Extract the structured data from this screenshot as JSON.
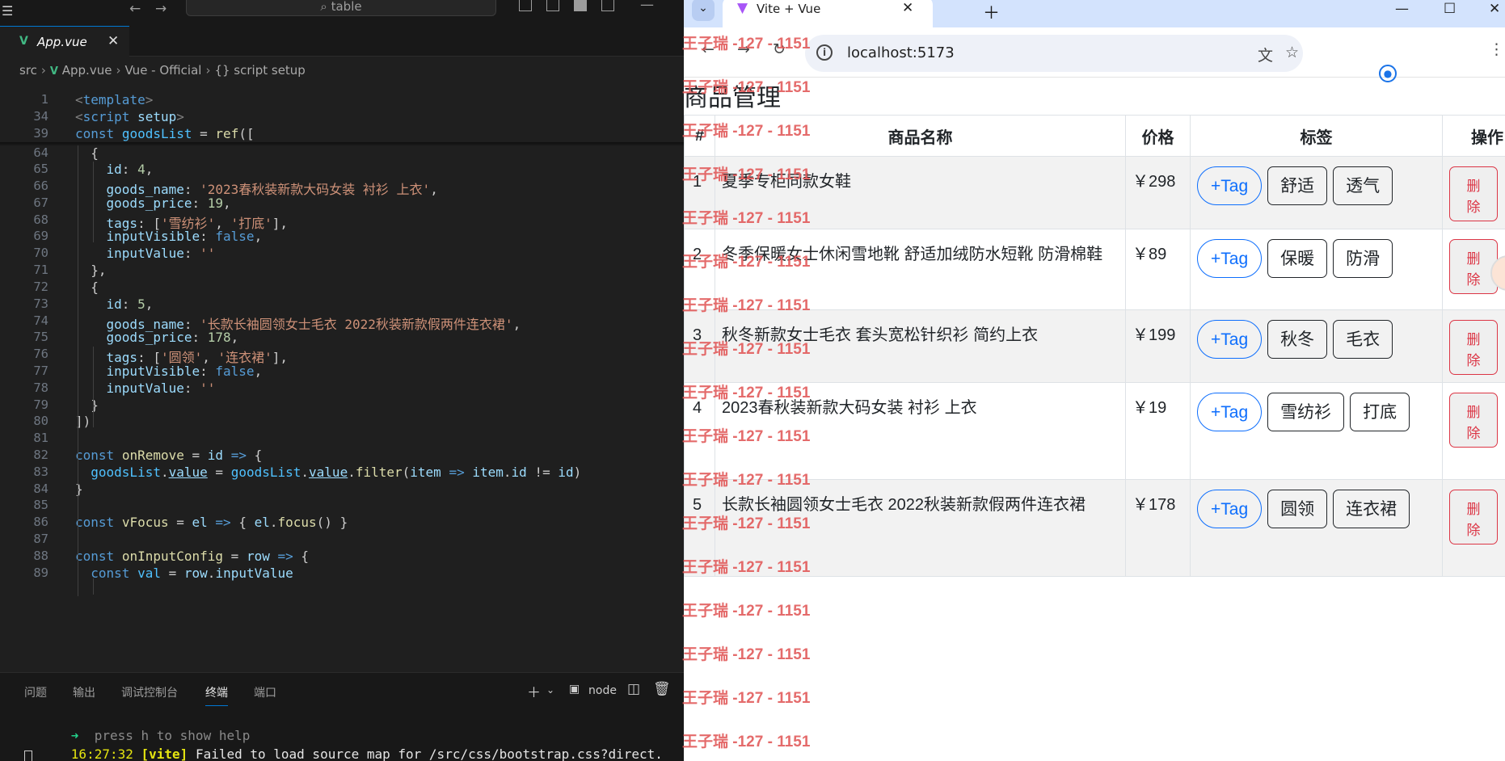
{
  "editor": {
    "command_center": "table",
    "tab_name": "App.vue",
    "breadcrumb": [
      "src",
      "App.vue",
      "Vue - Official",
      "{} script setup"
    ],
    "panel_tabs": [
      "问题",
      "输出",
      "调试控制台",
      "终端",
      "端口"
    ],
    "terminal_profile": "node",
    "terminal_line1_arrow": "➜",
    "terminal_line1_text": "press h to show help",
    "terminal_line2_time": "16:27:32",
    "terminal_line2_tag": "[vite]",
    "terminal_line2_msg": "Failed to load source map for /src/css/bootstrap.css?direct."
  },
  "code_lines": [
    {
      "n": "1",
      "h": "<span class=\"t\">&lt;</span><span class=\"k\">template</span><span class=\"t\">&gt;</span>"
    },
    {
      "n": "34",
      "h": "<span class=\"t\">&lt;</span><span class=\"k\">script</span> <span class=\"p\">setup</span><span class=\"t\">&gt;</span>"
    },
    {
      "n": "39",
      "h": "<span class=\"k\">const</span> <span class=\"v2\">goodsList</span> = <span class=\"f\">ref</span>(["
    },
    {
      "n": "64",
      "h": "  {"
    },
    {
      "n": "65",
      "h": "    <span class=\"p\">id</span>: <span class=\"n\">4</span>,"
    },
    {
      "n": "66",
      "h": "    <span class=\"p\">goods_name</span>: <span class=\"s\">'2023春秋装新款大码女装 衬衫 上衣'</span>,"
    },
    {
      "n": "67",
      "h": "    <span class=\"p\">goods_price</span>: <span class=\"n\">19</span>,"
    },
    {
      "n": "68",
      "h": "    <span class=\"p\">tags</span>: [<span class=\"s\">'雪纺衫'</span>, <span class=\"s\">'打底'</span>],"
    },
    {
      "n": "69",
      "h": "    <span class=\"p\">inputVisible</span>: <span class=\"k\">false</span>,"
    },
    {
      "n": "70",
      "h": "    <span class=\"p\">inputValue</span>: <span class=\"s\">''</span>"
    },
    {
      "n": "71",
      "h": "  },"
    },
    {
      "n": "72",
      "h": "  {"
    },
    {
      "n": "73",
      "h": "    <span class=\"p\">id</span>: <span class=\"n\">5</span>,"
    },
    {
      "n": "74",
      "h": "    <span class=\"p\">goods_name</span>: <span class=\"s\">'长款长袖圆领女士毛衣 2022秋装新款假两件连衣裙'</span>,"
    },
    {
      "n": "75",
      "h": "    <span class=\"p\">goods_price</span>: <span class=\"n\">178</span>,"
    },
    {
      "n": "76",
      "h": "    <span class=\"p\">tags</span>: [<span class=\"s\">'圆领'</span>, <span class=\"s\">'连衣裙'</span>],"
    },
    {
      "n": "77",
      "h": "    <span class=\"p\">inputVisible</span>: <span class=\"k\">false</span>,"
    },
    {
      "n": "78",
      "h": "    <span class=\"p\">inputValue</span>: <span class=\"s\">''</span>"
    },
    {
      "n": "79",
      "h": "  }"
    },
    {
      "n": "80",
      "h": "])"
    },
    {
      "n": "81",
      "h": ""
    },
    {
      "n": "82",
      "h": "<span class=\"k\">const</span> <span class=\"f\">onRemove</span> = <span class=\"p\">id</span> <span class=\"k\">=&gt;</span> {"
    },
    {
      "n": "83",
      "h": "  <span class=\"v2\">goodsList</span>.<span class=\"p u\">value</span> = <span class=\"v2\">goodsList</span>.<span class=\"p u\">value</span>.<span class=\"f\">filter</span>(<span class=\"p\">item</span> <span class=\"k\">=&gt;</span> <span class=\"p\">item</span>.<span class=\"p\">id</span> != <span class=\"p\">id</span>)"
    },
    {
      "n": "84",
      "h": "}"
    },
    {
      "n": "85",
      "h": ""
    },
    {
      "n": "86",
      "h": "<span class=\"k\">const</span> <span class=\"f\">vFocus</span> = <span class=\"p\">el</span> <span class=\"k\">=&gt;</span> { <span class=\"p\">el</span>.<span class=\"f\">focus</span>() }"
    },
    {
      "n": "87",
      "h": ""
    },
    {
      "n": "88",
      "h": "<span class=\"k\">const</span> <span class=\"f\">onInputConfig</span> = <span class=\"p\">row</span> <span class=\"k\">=&gt;</span> {"
    },
    {
      "n": "89",
      "h": "  <span class=\"k\">const</span> <span class=\"v2\">val</span> = <span class=\"p\">row</span>.<span class=\"p\">inputValue</span>"
    }
  ],
  "browser": {
    "tab_title": "Vite + Vue",
    "url": "localhost:5173"
  },
  "page": {
    "heading": "商品管理",
    "columns": [
      "#",
      "商品名称",
      "价格",
      "标签",
      "操作"
    ],
    "add_tag_label": "+Tag",
    "delete_label": "删除",
    "rows": [
      {
        "id": "1",
        "name": "夏季专柜同款女鞋",
        "price": "￥298",
        "tags": [
          "舒适",
          "透气"
        ]
      },
      {
        "id": "2",
        "name": "冬季保暖女士休闲雪地靴 舒适加绒防水短靴 防滑棉鞋",
        "price": "￥89",
        "tags": [
          "保暖",
          "防滑"
        ]
      },
      {
        "id": "3",
        "name": "秋冬新款女士毛衣 套头宽松针织衫 简约上衣",
        "price": "￥199",
        "tags": [
          "秋冬",
          "毛衣"
        ]
      },
      {
        "id": "4",
        "name": "2023春秋装新款大码女装 衬衫 上衣",
        "price": "￥19",
        "tags": [
          "雪纺衫",
          "打底"
        ]
      },
      {
        "id": "5",
        "name": "长款长袖圆领女士毛衣 2022秋装新款假两件连衣裙",
        "price": "￥178",
        "tags": [
          "圆领",
          "连衣裙"
        ]
      }
    ]
  },
  "watermark": "王子瑞 -127 - 1151",
  "colors": {
    "accent": "#0d6efd",
    "danger": "#dc3545",
    "vue_green": "#41b883",
    "watermark": "#e25b5b"
  }
}
